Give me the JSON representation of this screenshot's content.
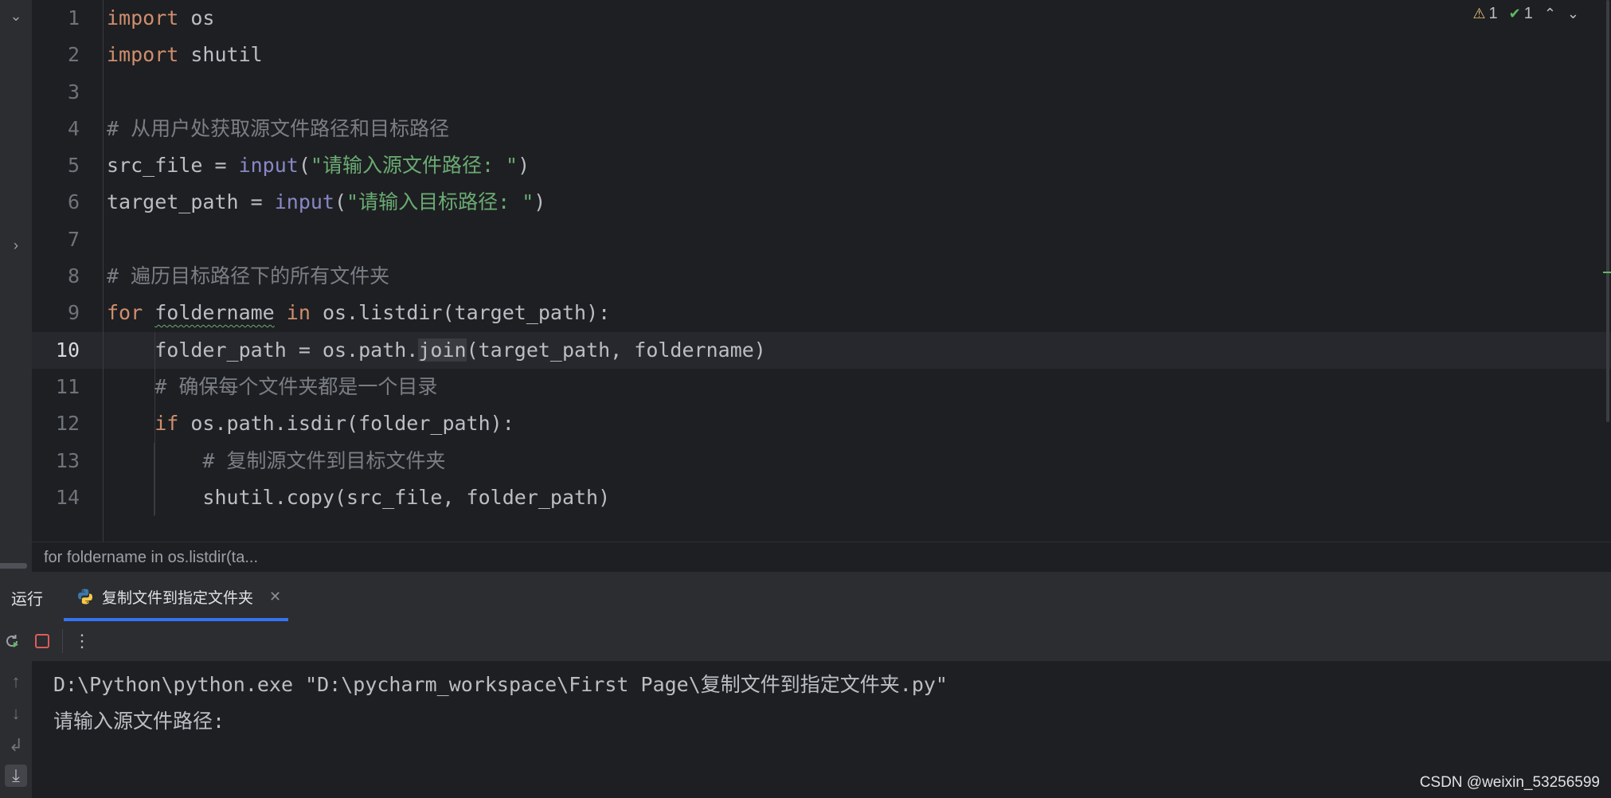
{
  "editor": {
    "inspections": {
      "warnings": "1",
      "ok": "1"
    },
    "current_line": 10,
    "line_numbers": [
      "1",
      "2",
      "3",
      "4",
      "5",
      "6",
      "7",
      "8",
      "9",
      "10",
      "11",
      "12",
      "13",
      "14"
    ],
    "breadcrumb": "for foldername in os.listdir(ta..."
  },
  "run_window": {
    "title": "运行",
    "tab_label": "复制文件到指定文件夹",
    "console_lines": [
      "D:\\Python\\python.exe \"D:\\pycharm_workspace\\First Page\\复制文件到指定文件夹.py\"",
      "请输入源文件路径: "
    ]
  },
  "watermark": "CSDN @weixin_53256599",
  "colors": {
    "keyword": "#cf8e6d",
    "builtin": "#8888c6",
    "string": "#6aab73",
    "comment": "#7a7e85",
    "accent": "#3574f0"
  }
}
